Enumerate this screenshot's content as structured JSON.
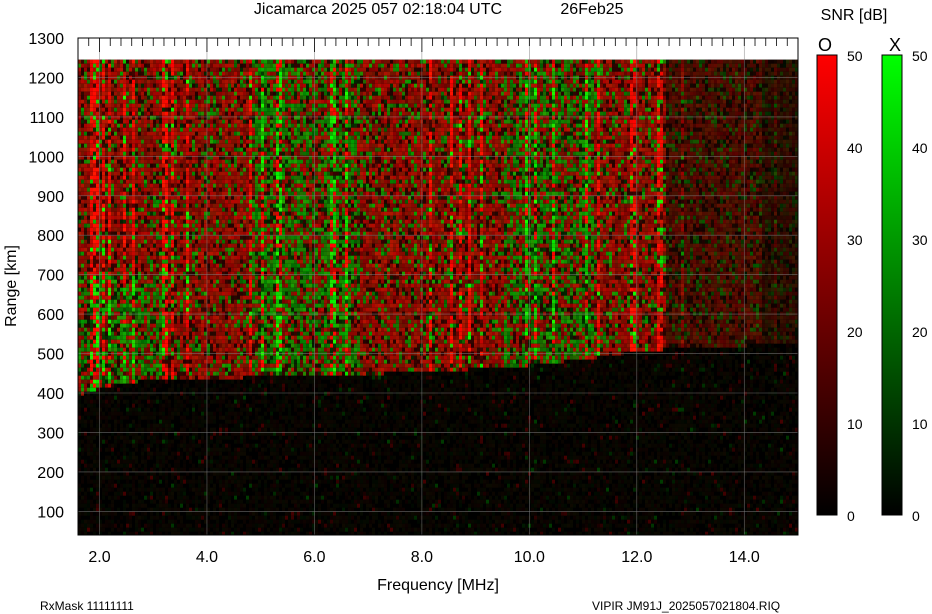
{
  "header": {
    "station_time": "Jicamarca 2025 057 02:18:04 UTC",
    "date": "26Feb25"
  },
  "footer": {
    "rx_mask": "RxMask 11111111",
    "file": "VIPIR  JM91J_2025057021804.RIQ"
  },
  "colorbar": {
    "title": "SNR [dB]",
    "o_label": "O",
    "x_label": "X",
    "ticks": [
      "50",
      "40",
      "30",
      "20",
      "10",
      "0"
    ],
    "o_color": "#ff0000",
    "x_color": "#00ff00"
  },
  "chart_data": {
    "type": "heatmap",
    "title": "Jicamarca 2025 057 02:18:04 UTC",
    "xlabel": "Frequency [MHz]",
    "ylabel": "Range [km]",
    "xlim": [
      1.6,
      15.0
    ],
    "ylim": [
      40,
      1300
    ],
    "x_ticks": [
      "2.0",
      "4.0",
      "6.0",
      "8.0",
      "10.0",
      "12.0",
      "14.0"
    ],
    "y_ticks": [
      "100",
      "200",
      "300",
      "400",
      "500",
      "600",
      "700",
      "800",
      "900",
      "1000",
      "1100",
      "1200",
      "1300"
    ],
    "zlim": [
      0,
      50
    ],
    "zlabel": "SNR [dB]",
    "grid": true,
    "data_range_max_km": 1245,
    "series": [
      {
        "name": "O",
        "color": "#ff0000"
      },
      {
        "name": "X",
        "color": "#00ff00"
      }
    ],
    "echo_floor_km": [
      [
        1.6,
        400
      ],
      [
        2.2,
        425
      ],
      [
        3.0,
        440
      ],
      [
        4.0,
        442
      ],
      [
        5.0,
        445
      ],
      [
        6.0,
        448
      ],
      [
        7.0,
        452
      ],
      [
        8.0,
        460
      ],
      [
        9.0,
        465
      ],
      [
        10.0,
        475
      ],
      [
        11.0,
        490
      ],
      [
        12.0,
        510
      ],
      [
        13.0,
        520
      ],
      [
        14.0,
        525
      ],
      [
        15.0,
        530
      ]
    ]
  }
}
